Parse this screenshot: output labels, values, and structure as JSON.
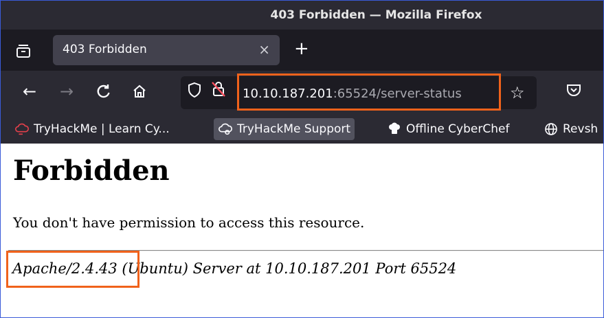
{
  "window": {
    "title": "403 Forbidden — Mozilla Firefox"
  },
  "tabs": [
    {
      "label": "403 Forbidden",
      "close_glyph": "×"
    }
  ],
  "new_tab_glyph": "+",
  "nav": {
    "back_glyph": "←",
    "forward_glyph": "→",
    "reload_glyph": "C",
    "url_host": "10.10.187.201",
    "url_rest": ":65524/server-status",
    "bookmark_star_glyph": "☆",
    "highlight_color": "#f0621b"
  },
  "bookmarks": [
    {
      "label": "TryHackMe | Learn Cy...",
      "icon": "tryhackme-cloud-icon"
    },
    {
      "label": "TryHackMe Support",
      "icon": "support-cloud-icon"
    },
    {
      "label": "Offline CyberChef",
      "icon": "chef-hat-icon"
    },
    {
      "label": "Revsh",
      "icon": "globe-icon"
    }
  ],
  "page": {
    "heading": "Forbidden",
    "message": "You don't have permission to access this resource.",
    "server_version": "Apache/2.4.43",
    "server_rest": " (Ubuntu) Server at 10.10.187.201 Port 65524"
  }
}
